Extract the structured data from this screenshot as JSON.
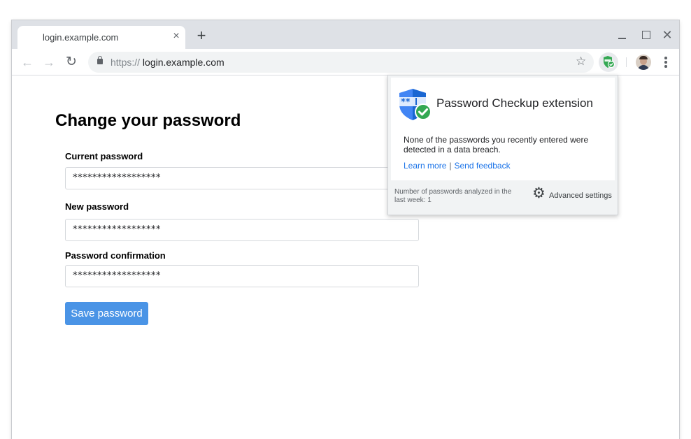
{
  "browser": {
    "tab_title": "login.example.com",
    "tab_close_glyph": "×",
    "new_tab_glyph": "+",
    "close_window_glyph": "✕",
    "url_scheme": "https://",
    "url_host": "login.example.com"
  },
  "page": {
    "title": "Change your password",
    "fields": [
      {
        "label": "Current password",
        "value": "******************"
      },
      {
        "label": "New password",
        "value": "******************"
      },
      {
        "label": "Password confirmation",
        "value": "******************"
      }
    ],
    "save_label": "Save password"
  },
  "popup": {
    "title": "Password Checkup extension",
    "message": "None of the passwords you recently entered were detected in a data breach.",
    "learn_more": "Learn more",
    "divider": "|",
    "send_feedback": "Send feedback",
    "stats": "Number of passwords analyzed in the last week: 1",
    "advanced_settings": "Advanced settings"
  },
  "icons": {
    "back": "arrow-back-icon",
    "forward": "arrow-forward-icon",
    "reload": "reload-icon",
    "lock": "lock-icon",
    "star": "bookmark-star-icon",
    "extension": "password-checkup-shield-icon",
    "avatar": "profile-avatar",
    "menu": "kebab-menu-icon",
    "gear": "gear-icon"
  },
  "colors": {
    "accent_blue": "#4a94e6",
    "link_blue": "#1a73e8",
    "check_green": "#34a853",
    "shield_blue": "#4285f4",
    "titlebar": "#dee1e6"
  }
}
